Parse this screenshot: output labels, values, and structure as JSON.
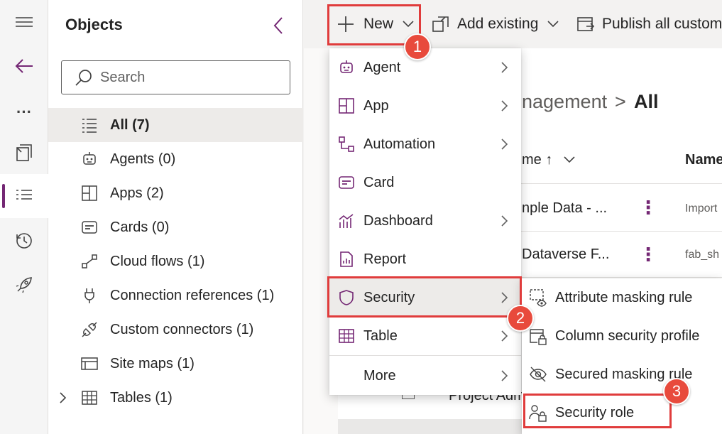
{
  "objects_panel": {
    "title": "Objects",
    "search_placeholder": "Search",
    "items": [
      {
        "label": "All",
        "count": "(7)",
        "icon": "list-icon"
      },
      {
        "label": "Agents",
        "count": "(0)",
        "icon": "bot-icon"
      },
      {
        "label": "Apps",
        "count": "(2)",
        "icon": "apps-grid-icon"
      },
      {
        "label": "Cards",
        "count": "(0)",
        "icon": "card-icon"
      },
      {
        "label": "Cloud flows",
        "count": "(1)",
        "icon": "flow-icon"
      },
      {
        "label": "Connection references",
        "count": "(1)",
        "icon": "plug-icon"
      },
      {
        "label": "Custom connectors",
        "count": "(1)",
        "icon": "connector-icon"
      },
      {
        "label": "Site maps",
        "count": "(1)",
        "icon": "sitemap-icon"
      },
      {
        "label": "Tables",
        "count": "(1)",
        "icon": "table-icon"
      }
    ]
  },
  "command_bar": {
    "new_label": "New",
    "add_existing_label": "Add existing",
    "publish_label": "Publish all customi"
  },
  "breadcrumb": {
    "partial": "nagement",
    "separator": ">",
    "current": "All"
  },
  "grid": {
    "col_name": "me ↑",
    "col_name2": "Name",
    "rows": [
      {
        "display": "nple Data - ...",
        "name": "Import"
      },
      {
        "display": "Dataverse F...",
        "name": "fab_sh"
      },
      {
        "display": "Project Adm",
        "name": ""
      }
    ]
  },
  "new_menu": {
    "items": [
      {
        "label": "Agent",
        "icon": "bot-icon",
        "submenu": true
      },
      {
        "label": "App",
        "icon": "apps-grid-icon",
        "submenu": true
      },
      {
        "label": "Automation",
        "icon": "automation-icon",
        "submenu": true
      },
      {
        "label": "Card",
        "icon": "card-icon",
        "submenu": false
      },
      {
        "label": "Dashboard",
        "icon": "dashboard-icon",
        "submenu": true
      },
      {
        "label": "Report",
        "icon": "report-icon",
        "submenu": false
      },
      {
        "label": "Security",
        "icon": "shield-icon",
        "submenu": true
      },
      {
        "label": "Table",
        "icon": "table-icon",
        "submenu": true
      },
      {
        "label": "More",
        "icon": "",
        "submenu": true
      }
    ]
  },
  "security_submenu": {
    "items": [
      {
        "label": "Attribute masking rule",
        "icon": "attribute-mask-icon"
      },
      {
        "label": "Column security profile",
        "icon": "column-lock-icon"
      },
      {
        "label": "Secured masking rule",
        "icon": "eye-off-icon"
      },
      {
        "label": "Security role",
        "icon": "people-lock-icon"
      }
    ]
  },
  "callouts": {
    "one": "1",
    "two": "2",
    "three": "3"
  },
  "colors": {
    "accent": "#742774",
    "highlight": "#e03c3c",
    "badge": "#e84a3c"
  }
}
